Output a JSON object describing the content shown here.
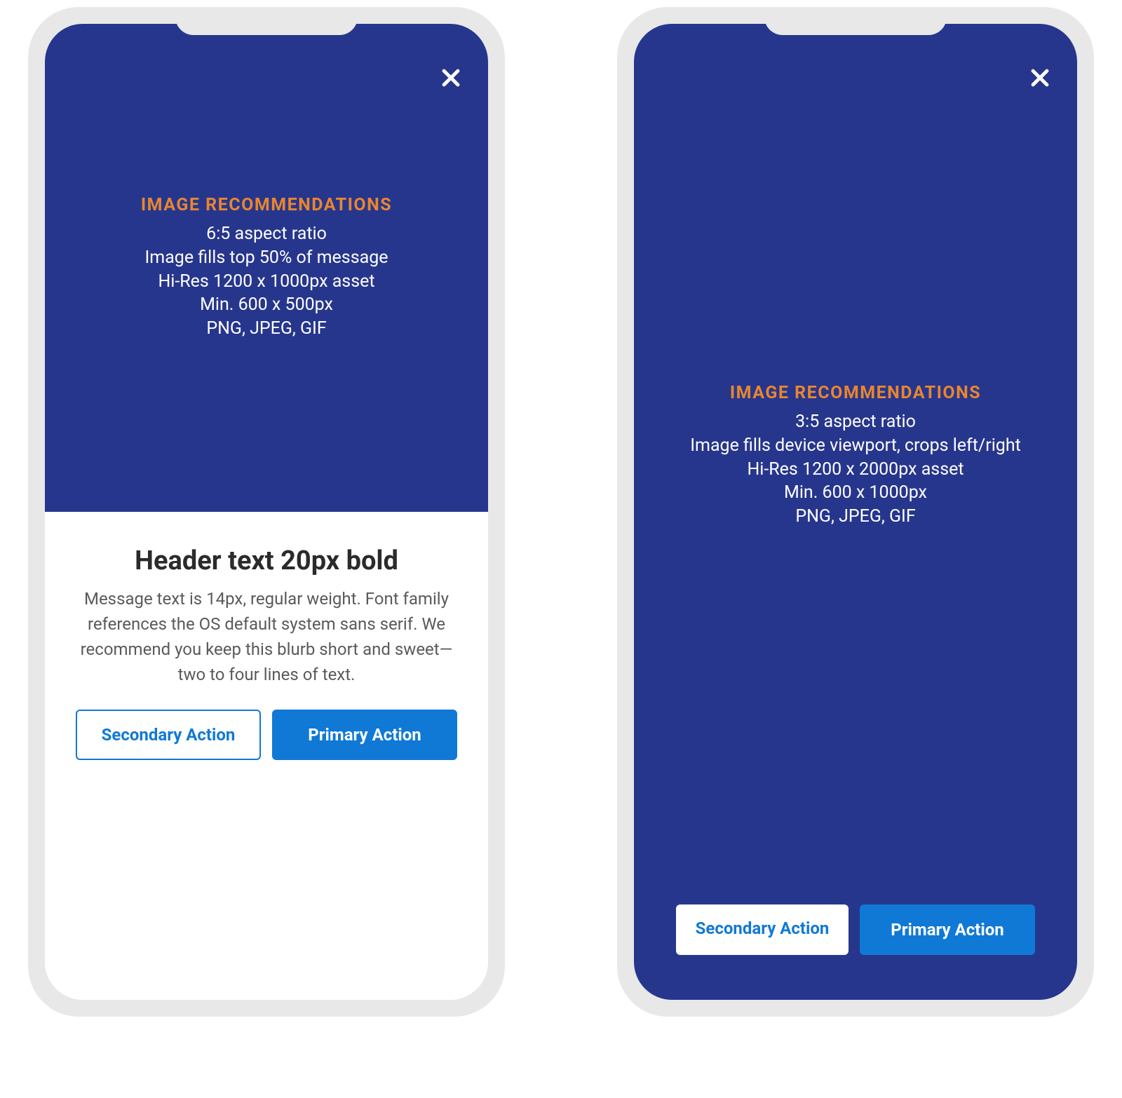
{
  "colors": {
    "hero_bg": "#27368d",
    "accent_orange": "#e8862e",
    "primary_blue": "#1079d6"
  },
  "left": {
    "recommendations_title": "IMAGE RECOMMENDATIONS",
    "rec_lines": {
      "0": "6:5 aspect ratio",
      "1": "Image fills top 50% of message",
      "2": "Hi-Res 1200 x 1000px asset",
      "3": "Min. 600 x 500px",
      "4": "PNG, JPEG, GIF"
    },
    "header": "Header text 20px bold",
    "body": "Message text is 14px, regular weight. Font family references the OS default system sans serif. We recommend you keep this blurb short and sweet—two to four lines of text.",
    "secondary_label": "Secondary Action",
    "primary_label": "Primary Action"
  },
  "right": {
    "recommendations_title": "IMAGE  RECOMMENDATIONS",
    "rec_lines": {
      "0": "3:5 aspect ratio",
      "1": "Image fills device viewport, crops left/right",
      "2": "Hi-Res 1200 x 2000px asset",
      "3": "Min. 600 x 1000px",
      "4": "PNG, JPEG, GIF"
    },
    "secondary_label": "Secondary Action",
    "primary_label": "Primary Action"
  }
}
